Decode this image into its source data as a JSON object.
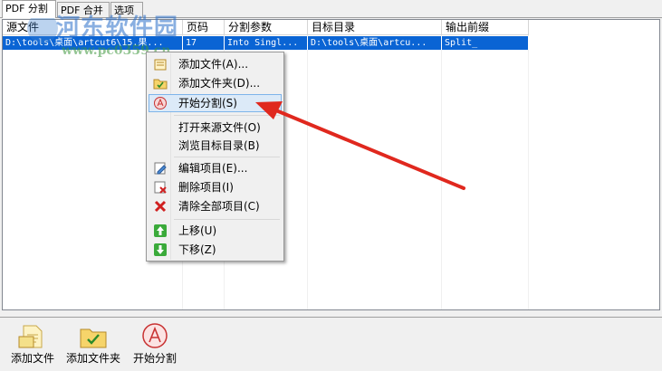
{
  "tabs": [
    {
      "label": "PDF 分割"
    },
    {
      "label": "PDF 合并"
    },
    {
      "label": "选项"
    }
  ],
  "watermark": {
    "title": "河东软件园",
    "url": "www.pc0359.cn"
  },
  "list": {
    "columns": [
      "源文件",
      "页码",
      "分割参数",
      "目标目录",
      "输出前缀"
    ],
    "rows": [
      {
        "source": "D:\\tools\\桌面\\artcut6\\15.果...",
        "pages": "17",
        "params": "Into Singl...",
        "target": "D:\\tools\\桌面\\artcu...",
        "prefix": "Split_"
      }
    ]
  },
  "context_menu": {
    "items": [
      {
        "label": "添加文件(A)...",
        "icon": "add-file-icon"
      },
      {
        "label": "添加文件夹(D)...",
        "icon": "add-folder-icon"
      },
      {
        "label": "开始分割(S)",
        "icon": "start-split-icon"
      },
      {
        "label": "打开来源文件(O)",
        "icon": ""
      },
      {
        "label": "浏览目标目录(B)",
        "icon": ""
      },
      {
        "label": "编辑项目(E)...",
        "icon": "edit-icon"
      },
      {
        "label": "删除项目(I)",
        "icon": "delete-icon"
      },
      {
        "label": "清除全部项目(C)",
        "icon": "clear-all-icon"
      },
      {
        "label": "上移(U)",
        "icon": "move-up-icon"
      },
      {
        "label": "下移(Z)",
        "icon": "move-down-icon"
      }
    ]
  },
  "toolbar": {
    "add_file": "添加文件",
    "add_folder": "添加文件夹",
    "start_split": "开始分割"
  },
  "colors": {
    "selection": "#0a64d4",
    "arrow": "#e0281e",
    "menu_highlight": "#dceaf8"
  }
}
